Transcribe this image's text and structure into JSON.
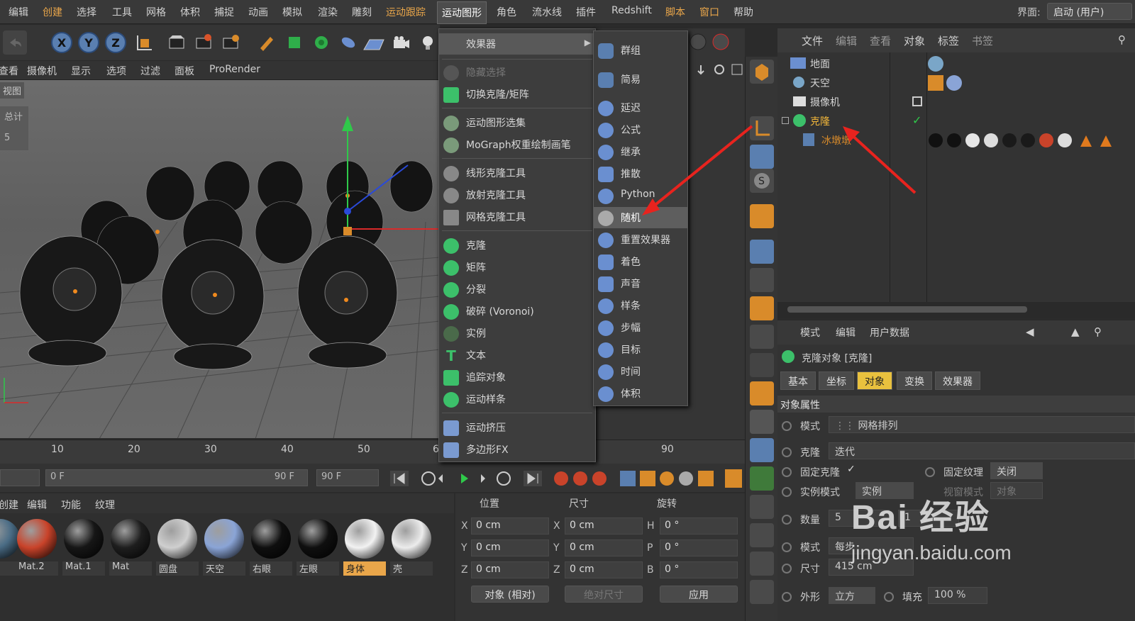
{
  "menubar": {
    "items": [
      "编辑",
      "创建",
      "选择",
      "工具",
      "网格",
      "体积",
      "捕捉",
      "动画",
      "模拟",
      "渲染",
      "雕刻",
      "运动跟踪",
      "运动图形",
      "角色",
      "流水线",
      "插件",
      "Redshift",
      "脚本",
      "窗口",
      "帮助"
    ],
    "interface_label": "界面:",
    "interface_value": "启动 (用户)"
  },
  "toolbar": {
    "axis_x": "X",
    "axis_y": "Y",
    "axis_z": "Z"
  },
  "viewport_menu": [
    "查看",
    "摄像机",
    "显示",
    "选项",
    "过滤",
    "面板",
    "ProRender"
  ],
  "viewport": {
    "label": "视图",
    "stats_label": "总计",
    "stats_value": "5"
  },
  "mograph_menu": {
    "items": [
      "效果器",
      "隐藏选择",
      "切换克隆/矩阵",
      "运动图形选集",
      "MoGraph权重绘制画笔",
      "线形克隆工具",
      "放射克隆工具",
      "网格克隆工具",
      "克隆",
      "矩阵",
      "分裂",
      "破碎 (Voronoi)",
      "实例",
      "文本",
      "追踪对象",
      "运动样条",
      "运动挤压",
      "多边形FX"
    ]
  },
  "effectors_menu": {
    "items": [
      "群组",
      "简易",
      "延迟",
      "公式",
      "继承",
      "推散",
      "Python",
      "随机",
      "重置效果器",
      "着色",
      "声音",
      "样条",
      "步幅",
      "目标",
      "时间",
      "体积"
    ]
  },
  "timeline": {
    "ticks": [
      "10",
      "20",
      "30",
      "40",
      "50",
      "6",
      "90"
    ],
    "frame_field": "0 F",
    "range_start": "0 F",
    "range_end": "90 F",
    "end_field": "90 F"
  },
  "material_manager": {
    "menu": [
      "创建",
      "编辑",
      "功能",
      "纹理"
    ],
    "materials": [
      {
        "name": "",
        "color": "#4a6c85"
      },
      {
        "name": "Mat.2",
        "color": "#c9432a"
      },
      {
        "name": "Mat.1",
        "color": "#161616"
      },
      {
        "name": "Mat",
        "color": "#1e1e1e"
      },
      {
        "name": "圆盘",
        "color": "#cfcfcf"
      },
      {
        "name": "天空",
        "color": "#8aa4d6"
      },
      {
        "name": "右眼",
        "color": "#0f0f0f"
      },
      {
        "name": "左眼",
        "color": "#0f0f0f"
      },
      {
        "name": "身体",
        "color": "#f2f2f2"
      },
      {
        "name": "壳",
        "color": "#ececec"
      }
    ]
  },
  "coordinates": {
    "headers": [
      "位置",
      "尺寸",
      "旋转"
    ],
    "rows": [
      {
        "axis": "X",
        "pos": "0 cm",
        "saxis": "X",
        "size": "0 cm",
        "raxis": "H",
        "rot": "0 °"
      },
      {
        "axis": "Y",
        "pos": "0 cm",
        "saxis": "Y",
        "size": "0 cm",
        "raxis": "P",
        "rot": "0 °"
      },
      {
        "axis": "Z",
        "pos": "0 cm",
        "saxis": "Z",
        "size": "0 cm",
        "raxis": "B",
        "rot": "0 °"
      }
    ],
    "mode_select": "对象 (相对)",
    "size_select": "绝对尺寸",
    "apply": "应用"
  },
  "object_manager": {
    "menu": [
      "文件",
      "编辑",
      "查看",
      "对象",
      "标签",
      "书签"
    ],
    "objects": [
      "地面",
      "天空",
      "摄像机",
      "克隆",
      "冰墩墩"
    ]
  },
  "attribute_manager": {
    "menu": [
      "模式",
      "编辑",
      "用户数据"
    ],
    "title": "克隆对象 [克隆]",
    "tabs": [
      "基本",
      "坐标",
      "对象",
      "变换",
      "效果器"
    ],
    "section": "对象属性",
    "mode_label": "模式",
    "mode_value": "网格排列",
    "clone_label": "克隆",
    "clone_value": "迭代",
    "fixed_clone_label": "固定克隆",
    "fixed_texture_label": "固定纹理",
    "fixed_texture_value": "关闭",
    "instance_mode_label": "实例模式",
    "instance_mode_value": "实例",
    "viewport_mode_label": "视窗模式",
    "viewport_mode_value": "对象",
    "count_label": "数量",
    "count_value": "5",
    "count_value2": "1",
    "mode2_label": "模式",
    "mode2_value": "每步",
    "size_label": "尺寸",
    "size_value": "415 cm",
    "shape_label": "外形",
    "shape_value": "立方",
    "fill_label": "填充",
    "fill_value": "100 %"
  },
  "watermark": {
    "text": "Bai 经验",
    "url": "jingyan.baidu.com"
  }
}
